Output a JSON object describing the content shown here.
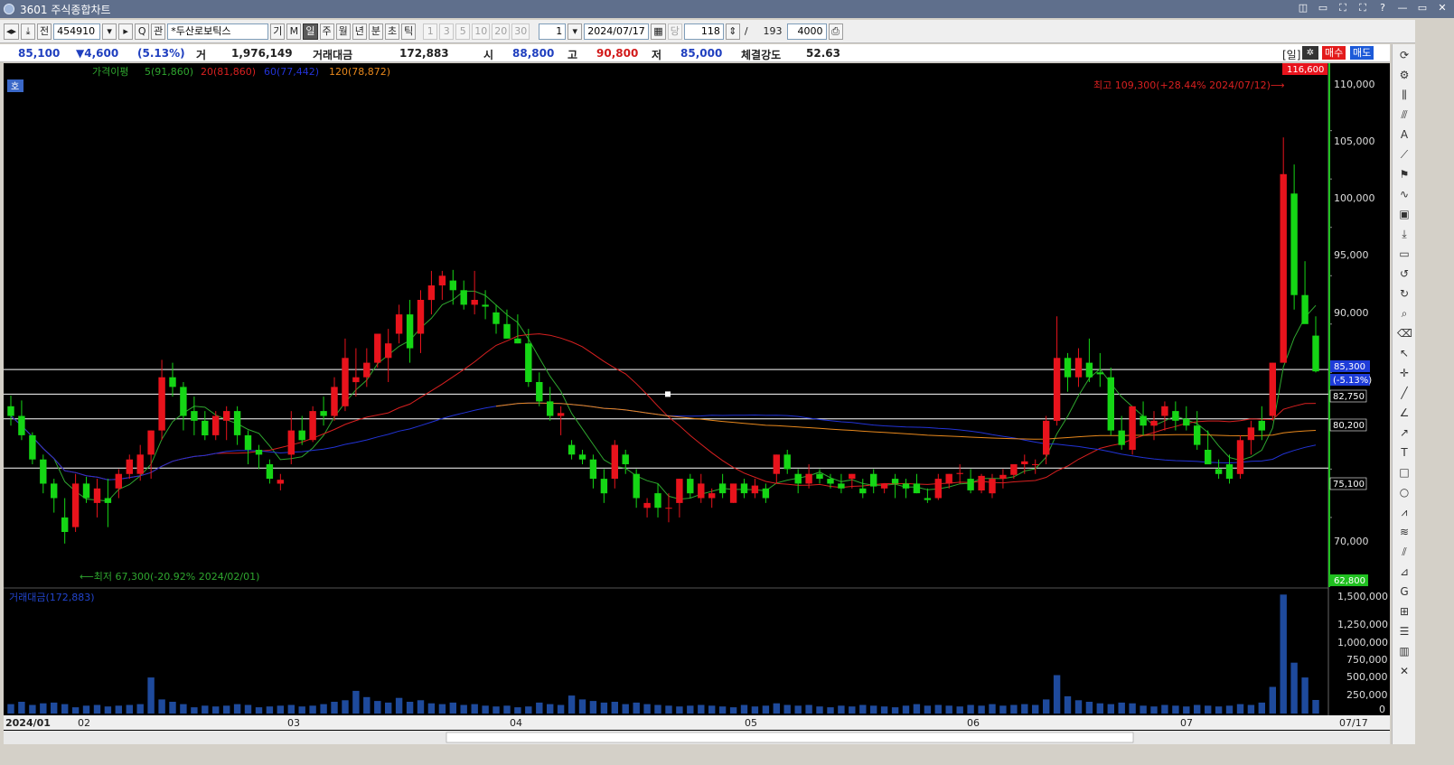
{
  "window": {
    "title": "3601 주식종합차트",
    "controls": [
      "◫",
      "▭",
      "⛶",
      "⛶",
      "?",
      "—",
      "▭",
      "✕"
    ]
  },
  "toolbar": {
    "prev_label": "◂▸",
    "download_label": "⤓",
    "all_label": "전",
    "code": "454910",
    "search_label": "Q",
    "related_label": "관",
    "name": "*두산로보틱스",
    "gi_label": "기",
    "m_label": "M",
    "period_tabs": [
      "일",
      "주",
      "월",
      "년",
      "분",
      "초",
      "틱"
    ],
    "active_period": "일",
    "minute_options": [
      "1",
      "3",
      "5",
      "10",
      "20",
      "30"
    ],
    "unit_value": "1",
    "date": "2024/07/17",
    "dang_label": "당",
    "count": "118",
    "slash": "/",
    "total": "193",
    "display_count": "4000"
  },
  "quote": {
    "price": "85,100",
    "change": "▼4,600",
    "change_pct": "(5.13%)",
    "volume_label": "거",
    "volume": "1,976,149",
    "amount_label": "거래대금",
    "amount": "172,883",
    "open_label": "시",
    "open": "88,800",
    "high_label": "고",
    "high": "90,800",
    "low_label": "저",
    "low": "85,000",
    "strength_label": "체결강도",
    "strength": "52.63",
    "il_label": "[일]",
    "buy_label": "매수",
    "sell_label": "매도"
  },
  "legend": {
    "ma_title": "가격이평",
    "ma5": "5(91,860)",
    "ma20": "20(81,860)",
    "ma60": "60(77,442)",
    "ma120": "120(78,872)",
    "ho": "호"
  },
  "annotations": {
    "high": "최고 109,300(+28.44% 2024/07/12)⟶",
    "low": "⟵최저 67,300(-20.92% 2024/02/01)",
    "top_price": "116,600",
    "bottom_price": "62,800",
    "current_price": "85,300",
    "current_pct": "(-5.13%)"
  },
  "lines": [
    {
      "label": "82,750"
    },
    {
      "label": "80,200"
    },
    {
      "label": "75,100"
    }
  ],
  "price_axis": [
    "110,000",
    "105,000",
    "100,000",
    "95,000",
    "90,000",
    "85,000",
    "80,000",
    "75,000",
    "70,000"
  ],
  "volume_title": "거래대금(172,883)",
  "volume_axis": [
    "1,500,000",
    "1,250,000",
    "1,000,000",
    "750,000",
    "500,000",
    "250,000",
    "0"
  ],
  "date_axis": [
    "2024/01",
    "02",
    "03",
    "04",
    "05",
    "06",
    "07"
  ],
  "last_date": "07/17",
  "colors": {
    "up": "#e8131c",
    "down": "#15d615",
    "ma5": "#2fa62f",
    "ma20": "#d82020",
    "ma60": "#2233d6",
    "ma120": "#e8881c",
    "volume": "#1e4a9c"
  },
  "chart_data": {
    "type": "candlestick",
    "title": "",
    "symbol": "454910",
    "name": "*두산로보틱스",
    "y_range": [
      62800,
      116600
    ],
    "volume_range": [
      0,
      1500000
    ],
    "candles": [
      [
        81500,
        82600,
        79500,
        80500,
        120000
      ],
      [
        80500,
        82100,
        78000,
        78500,
        150000
      ],
      [
        78500,
        78800,
        75500,
        76000,
        110000
      ],
      [
        76000,
        76500,
        72500,
        73500,
        130000
      ],
      [
        73500,
        74000,
        70500,
        72000,
        140000
      ],
      [
        70000,
        72000,
        67300,
        68500,
        120000
      ],
      [
        69000,
        74500,
        68500,
        73500,
        80000
      ],
      [
        73500,
        74200,
        71500,
        72000,
        100000
      ],
      [
        71500,
        74000,
        70000,
        73000,
        110000
      ],
      [
        72000,
        74000,
        69000,
        71500,
        90000
      ],
      [
        73000,
        75000,
        72000,
        74500,
        100000
      ],
      [
        74500,
        76500,
        74000,
        76000,
        110000
      ],
      [
        74500,
        77500,
        73800,
        76500,
        120000
      ],
      [
        76500,
        79000,
        74000,
        79000,
        460000
      ],
      [
        79000,
        86300,
        78000,
        84500,
        180000
      ],
      [
        84500,
        86000,
        82500,
        83500,
        150000
      ],
      [
        83500,
        84000,
        79000,
        80500,
        120000
      ],
      [
        81000,
        82500,
        78500,
        80000,
        80000
      ],
      [
        80000,
        81000,
        78000,
        78500,
        100000
      ],
      [
        78500,
        81000,
        78000,
        80500,
        90000
      ],
      [
        80000,
        81500,
        78000,
        81000,
        100000
      ],
      [
        81000,
        81500,
        77500,
        78500,
        120000
      ],
      [
        78500,
        79000,
        75500,
        77000,
        110000
      ],
      [
        77000,
        77500,
        75000,
        76500,
        80000
      ],
      [
        75500,
        76000,
        73500,
        74000,
        90000
      ],
      [
        73500,
        74500,
        72800,
        73900,
        100000
      ],
      [
        76500,
        81000,
        75500,
        79000,
        110000
      ],
      [
        79000,
        80500,
        77500,
        78000,
        90000
      ],
      [
        78000,
        81500,
        77800,
        81000,
        100000
      ],
      [
        81000,
        82500,
        79500,
        80500,
        120000
      ],
      [
        80500,
        84500,
        80000,
        83500,
        150000
      ],
      [
        81500,
        88500,
        81000,
        86500,
        170000
      ],
      [
        84000,
        87500,
        82500,
        84500,
        290000
      ],
      [
        84500,
        87500,
        83500,
        86000,
        210000
      ],
      [
        86000,
        88500,
        85500,
        89000,
        160000
      ],
      [
        86500,
        89500,
        84000,
        88000,
        140000
      ],
      [
        89000,
        92000,
        88000,
        91000,
        200000
      ],
      [
        91000,
        92500,
        86000,
        87500,
        150000
      ],
      [
        89000,
        93500,
        87000,
        92500,
        170000
      ],
      [
        92500,
        95500,
        91000,
        94000,
        130000
      ],
      [
        94000,
        95500,
        92500,
        95000,
        120000
      ],
      [
        94500,
        95600,
        92000,
        93500,
        140000
      ],
      [
        93500,
        94500,
        91500,
        92000,
        110000
      ],
      [
        92000,
        95500,
        91000,
        92500,
        120000
      ],
      [
        92000,
        93500,
        90500,
        91800,
        100000
      ],
      [
        91200,
        92000,
        89000,
        90000,
        90000
      ],
      [
        90000,
        91500,
        89000,
        88500,
        100000
      ],
      [
        88500,
        91000,
        88000,
        88000,
        80000
      ],
      [
        88000,
        89500,
        83500,
        84000,
        90000
      ],
      [
        84000,
        85000,
        81500,
        82000,
        140000
      ],
      [
        82000,
        83500,
        80000,
        80500,
        120000
      ],
      [
        80500,
        81500,
        78500,
        80800,
        110000
      ],
      [
        77500,
        78000,
        76000,
        76500,
        230000
      ],
      [
        76500,
        77000,
        75500,
        76000,
        180000
      ],
      [
        76000,
        76500,
        73000,
        74000,
        160000
      ],
      [
        74000,
        75000,
        71500,
        72500,
        140000
      ],
      [
        74000,
        78000,
        73000,
        77500,
        150000
      ],
      [
        76500,
        77000,
        74500,
        75500,
        120000
      ],
      [
        74500,
        75000,
        71000,
        72000,
        140000
      ],
      [
        71000,
        72000,
        70000,
        71500,
        120000
      ],
      [
        72500,
        73500,
        70000,
        71000,
        110000
      ],
      [
        71000,
        72500,
        69500,
        71000,
        100000
      ],
      [
        71500,
        74000,
        70000,
        74000,
        90000
      ],
      [
        74000,
        74500,
        72000,
        72500,
        100000
      ],
      [
        72000,
        74500,
        71500,
        73500,
        110000
      ],
      [
        72000,
        73000,
        71000,
        72500,
        100000
      ],
      [
        73500,
        74500,
        72000,
        72500,
        90000
      ],
      [
        71500,
        73500,
        71500,
        73500,
        80000
      ],
      [
        73500,
        74000,
        72000,
        72500,
        110000
      ],
      [
        72500,
        74000,
        72000,
        73300,
        90000
      ],
      [
        73000,
        73500,
        71500,
        72000,
        100000
      ],
      [
        74500,
        76500,
        73500,
        76500,
        130000
      ],
      [
        76500,
        77000,
        74500,
        75000,
        110000
      ],
      [
        74500,
        75000,
        72500,
        73500,
        100000
      ],
      [
        73500,
        75500,
        73000,
        74500,
        110000
      ],
      [
        74500,
        75000,
        73500,
        74000,
        90000
      ],
      [
        74000,
        74500,
        73000,
        73500,
        80000
      ],
      [
        73500,
        74500,
        72500,
        73000,
        100000
      ],
      [
        74000,
        74500,
        73000,
        74500,
        90000
      ],
      [
        73000,
        74000,
        72000,
        72500,
        110000
      ],
      [
        74500,
        75000,
        72500,
        73200,
        100000
      ],
      [
        73000,
        73500,
        72500,
        73500,
        90000
      ],
      [
        74000,
        74500,
        72000,
        73500,
        80000
      ],
      [
        73500,
        74000,
        72000,
        73000,
        100000
      ],
      [
        73500,
        74500,
        72500,
        72500,
        120000
      ],
      [
        72000,
        73000,
        71500,
        71800,
        100000
      ],
      [
        72000,
        74500,
        71800,
        74000,
        110000
      ],
      [
        73500,
        74500,
        73000,
        74500,
        100000
      ],
      [
        74500,
        75500,
        73500,
        74600,
        90000
      ],
      [
        74000,
        75000,
        72500,
        72800,
        110000
      ],
      [
        72800,
        74500,
        72500,
        74300,
        100000
      ],
      [
        72500,
        74500,
        72000,
        74000,
        120000
      ],
      [
        74000,
        75000,
        73000,
        74400,
        100000
      ],
      [
        74400,
        75500,
        74000,
        75500,
        110000
      ],
      [
        75500,
        76500,
        74500,
        75800,
        120000
      ],
      [
        75500,
        76000,
        74500,
        75500,
        110000
      ],
      [
        76500,
        80500,
        75500,
        80000,
        180000
      ],
      [
        80000,
        90800,
        79500,
        86500,
        490000
      ],
      [
        86500,
        87000,
        83000,
        84500,
        220000
      ],
      [
        84500,
        87500,
        83500,
        86500,
        170000
      ],
      [
        86000,
        88500,
        84000,
        84500,
        150000
      ],
      [
        85000,
        87000,
        83500,
        84800,
        130000
      ],
      [
        84500,
        85500,
        78500,
        79000,
        120000
      ],
      [
        79000,
        80500,
        77000,
        77500,
        140000
      ],
      [
        77000,
        81500,
        76500,
        81500,
        130000
      ],
      [
        80500,
        82000,
        78500,
        79500,
        100000
      ],
      [
        79500,
        81000,
        78000,
        80000,
        90000
      ],
      [
        80500,
        82000,
        79000,
        81500,
        110000
      ],
      [
        81000,
        82000,
        79000,
        80000,
        100000
      ],
      [
        80200,
        81500,
        79000,
        79500,
        90000
      ],
      [
        79500,
        81000,
        77000,
        77500,
        110000
      ],
      [
        77000,
        79000,
        75500,
        75500,
        100000
      ],
      [
        75000,
        76000,
        74000,
        74500,
        90000
      ],
      [
        75500,
        76500,
        73500,
        74000,
        100000
      ],
      [
        74500,
        78500,
        74000,
        78000,
        120000
      ],
      [
        78000,
        80000,
        76500,
        79300,
        110000
      ],
      [
        80000,
        81500,
        78000,
        79000,
        140000
      ],
      [
        80500,
        86000,
        80000,
        86000,
        340000
      ],
      [
        86000,
        109300,
        91000,
        105500,
        1520000
      ],
      [
        103500,
        106500,
        91500,
        93000,
        650000
      ],
      [
        93000,
        96500,
        91000,
        90000,
        460000
      ],
      [
        88800,
        90800,
        85000,
        85100,
        172883
      ]
    ]
  }
}
